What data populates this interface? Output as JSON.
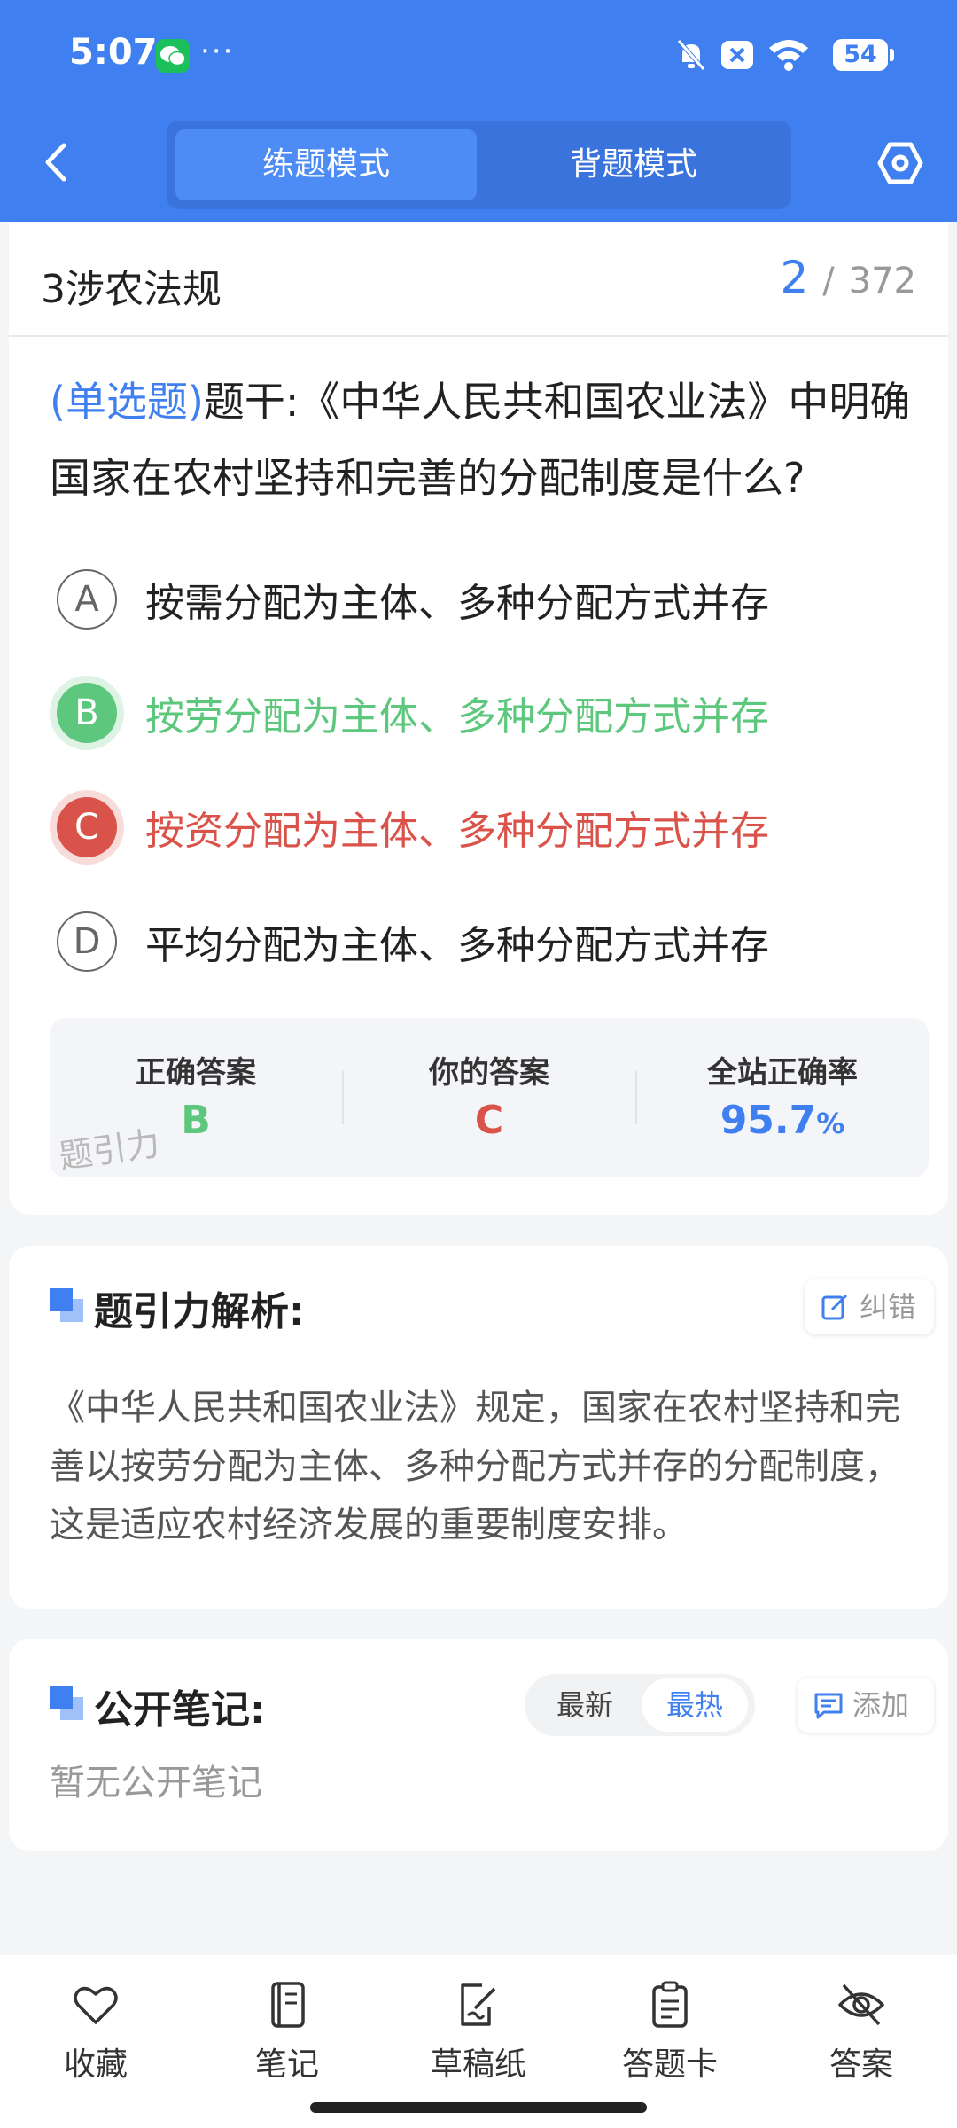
{
  "status_bar": {
    "time": "5:07",
    "dots": "···",
    "battery": "54"
  },
  "header": {
    "tabs": [
      {
        "label": "练题模式",
        "active": true
      },
      {
        "label": "背题模式",
        "active": false
      }
    ]
  },
  "chapter": {
    "title": "3涉农法规",
    "current": "2",
    "separator": "/",
    "total": "372"
  },
  "question": {
    "type_label": "(单选题)",
    "stem": "题干:《中华人民共和国农业法》中明确国家在农村坚持和完善的分配制度是什么?"
  },
  "options": [
    {
      "letter": "A",
      "text": "按需分配为主体、多种分配方式并存",
      "state": "normal"
    },
    {
      "letter": "B",
      "text": "按劳分配为主体、多种分配方式并存",
      "state": "correct"
    },
    {
      "letter": "C",
      "text": "按资分配为主体、多种分配方式并存",
      "state": "wrong"
    },
    {
      "letter": "D",
      "text": "平均分配为主体、多种分配方式并存",
      "state": "normal"
    }
  ],
  "result": {
    "correct_label": "正确答案",
    "correct_value": "B",
    "yours_label": "你的答案",
    "yours_value": "C",
    "rate_label": "全站正确率",
    "rate_value": "95.7",
    "rate_unit": "%",
    "watermark": "题引力"
  },
  "analysis": {
    "title": "题引力解析:",
    "report_label": "纠错",
    "text": "《中华人民共和国农业法》规定，国家在农村坚持和完善以按劳分配为主体、多种分配方式并存的分配制度，这是适应农村经济发展的重要制度安排。"
  },
  "notes": {
    "title": "公开笔记:",
    "sort_new": "最新",
    "sort_hot": "最热",
    "add_label": "添加",
    "empty": "暂无公开笔记"
  },
  "toolbar": {
    "items": [
      {
        "label": "收藏",
        "icon": "heart-icon"
      },
      {
        "label": "笔记",
        "icon": "notebook-icon"
      },
      {
        "label": "草稿纸",
        "icon": "draft-icon"
      },
      {
        "label": "答题卡",
        "icon": "clipboard-icon"
      },
      {
        "label": "答案",
        "icon": "eye-off-icon"
      }
    ]
  },
  "colors": {
    "primary": "#3f7ff0",
    "correct": "#5dc77d",
    "wrong": "#d9534a"
  }
}
